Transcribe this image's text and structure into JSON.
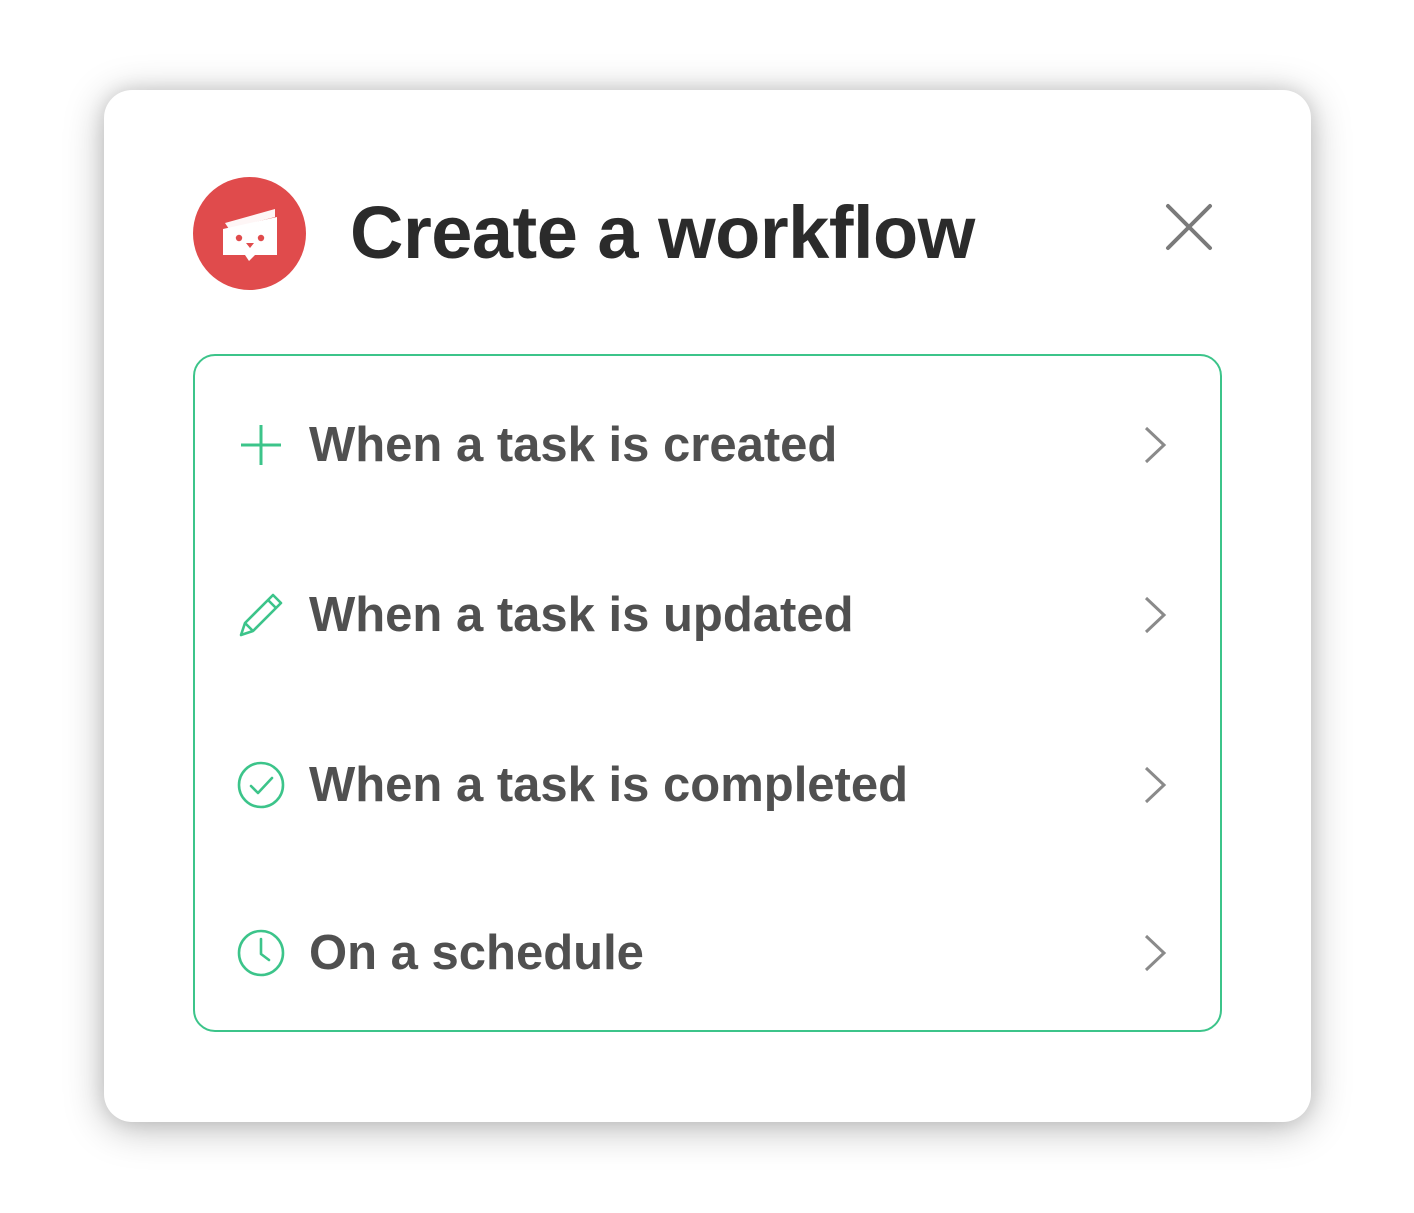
{
  "dialog": {
    "title": "Create a workflow",
    "close_icon": "close-icon",
    "logo_icon": "app-logo-icon"
  },
  "options": [
    {
      "label": "When a task is created",
      "icon": "plus-icon"
    },
    {
      "label": "When a task is updated",
      "icon": "pencil-icon"
    },
    {
      "label": "When a task is completed",
      "icon": "check-circle-icon"
    },
    {
      "label": "On a schedule",
      "icon": "clock-icon"
    }
  ],
  "colors": {
    "accent": "#3cc48a",
    "logo": "#e04b4c",
    "title": "#2b2b2b",
    "label": "#505050",
    "muted": "#8a8a8a"
  }
}
